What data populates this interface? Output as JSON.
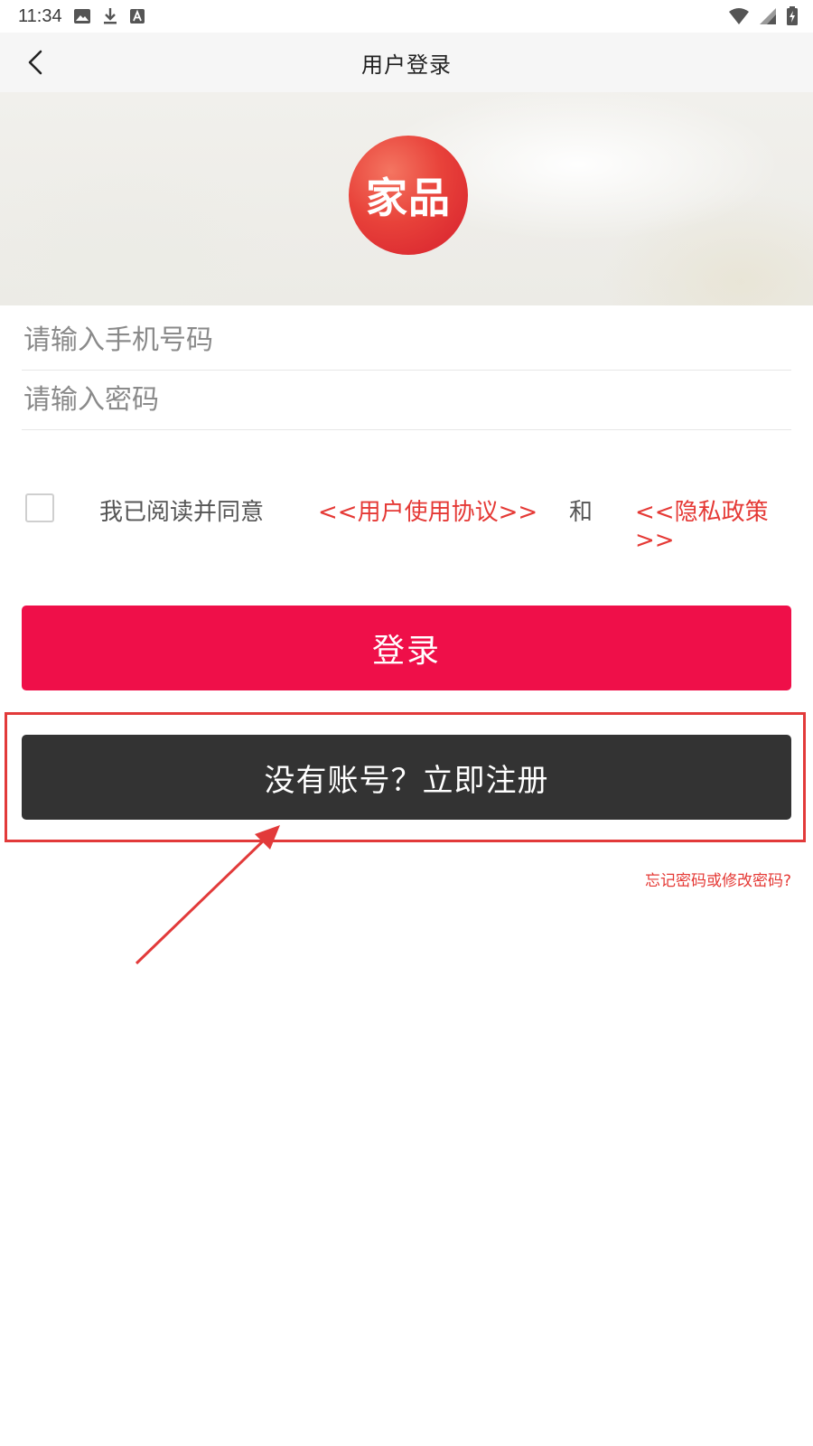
{
  "status_bar": {
    "time": "11:34",
    "left_icons": [
      "image-icon",
      "download-icon",
      "text-a-icon"
    ],
    "right_icons": [
      "wifi-icon",
      "signal-icon",
      "battery-icon"
    ]
  },
  "header": {
    "title": "用户登录",
    "back_icon": "chevron-left-icon"
  },
  "banner": {
    "logo_text": "家品"
  },
  "form": {
    "phone_placeholder": "请输入手机号码",
    "phone_value": "",
    "password_placeholder": "请输入密码",
    "password_value": ""
  },
  "agreement": {
    "checked": false,
    "prefix": "我已阅读并同意",
    "terms_link": "<<用户使用协议>>",
    "conjunction": "和",
    "privacy_link": "<<隐私政策>>"
  },
  "actions": {
    "login_label": "登录",
    "register_label": "没有账号？立即注册",
    "forgot_label": "忘记密码或修改密码?"
  },
  "colors": {
    "login_button": "#ef0f49",
    "register_button": "#333333",
    "link": "#e53935",
    "annotation": "#e23a3a"
  }
}
